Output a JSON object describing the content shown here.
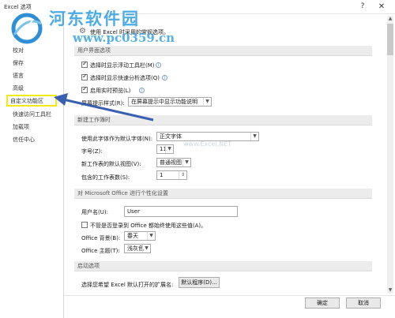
{
  "window": {
    "title": "Excel 选项",
    "help": "?",
    "close": "✕"
  },
  "watermark": {
    "title": "河东软件园",
    "url": "www.pc0359.cn",
    "faint": "www.Excel.NET"
  },
  "sidebar": {
    "items": [
      {
        "label": "校对"
      },
      {
        "label": "保存"
      },
      {
        "label": "语言"
      },
      {
        "label": "高级"
      },
      {
        "label": "自定义功能区"
      },
      {
        "label": "快速访问工具栏"
      },
      {
        "label": "加载项"
      },
      {
        "label": "信任中心"
      }
    ]
  },
  "main": {
    "intro": "使用 Excel 时采用的常规选项。",
    "ui_section": {
      "title": "用户界面选项",
      "mini_toolbar": "选择时显示浮动工具栏(M)",
      "quick_analysis": "选择时显示快速分析选项(Q)",
      "live_preview": "启用实时预览(L)",
      "screentip_label": "屏幕提示样式(R):",
      "screentip_value": "在屏幕提示中显示功能说明"
    },
    "new_wb_section": {
      "title": "新建工作簿时",
      "font_label": "使用此字体作为默认字体(N):",
      "font_value": "正文字体",
      "size_label": "字号(Z):",
      "size_value": "11",
      "view_label": "新工作表的默认视图(V):",
      "view_value": "普通视图",
      "sheets_label": "包含的工作表数(S):",
      "sheets_value": "1"
    },
    "personalize_section": {
      "title": "对 Microsoft Office 进行个性化设置",
      "username_label": "用户名(U):",
      "username_value": "User",
      "always_use": "不管是否登录到 Office 都始终使用这些值(A)。",
      "background_label": "Office 背景(B):",
      "background_value": "春天",
      "theme_label": "Office 主题(T):",
      "theme_value": "浅灰色"
    },
    "startup_section": {
      "title": "启动选项",
      "ext_label": "选择您希望 Excel 默认打开的扩展名:",
      "default_programs": "默认程序(D)..."
    }
  },
  "footer": {
    "ok": "确定",
    "cancel": "取消"
  },
  "colors": {
    "highlight": "#f2ea17",
    "arrow": "#3a5fb0",
    "watermark": "#3aa3e0"
  }
}
